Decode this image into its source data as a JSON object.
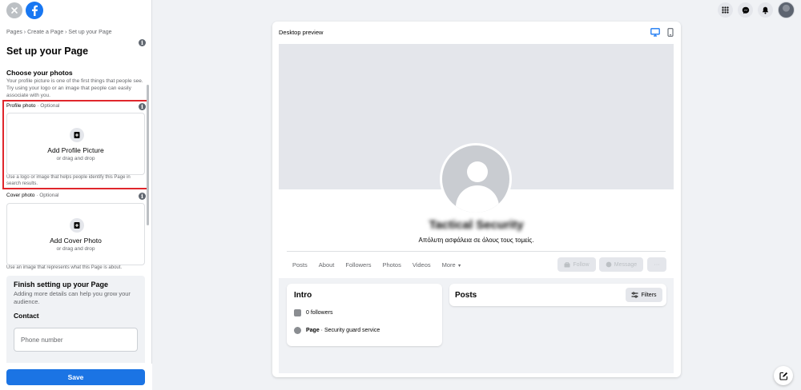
{
  "left_panel": {
    "breadcrumb": "Pages › Create a Page › Set up your Page",
    "title": "Set up your Page",
    "choose_photos": {
      "title": "Choose your photos",
      "description": "Your profile picture is one of the first things that people see. Try using your logo or an image that people can easily associate with you."
    },
    "profile_photo": {
      "label": "Profile photo",
      "optional": " · Optional",
      "button": "Add Profile Picture",
      "sub": "or drag and drop",
      "helper": "Use a logo or image that helps people identify this Page in search results."
    },
    "cover_photo": {
      "label": "Cover photo",
      "optional": " · Optional",
      "button": "Add Cover Photo",
      "sub": "or drag and drop",
      "helper": "Use an image that represents what this Page is about."
    },
    "finish": {
      "title": "Finish setting up your Page",
      "description": "Adding more details can help you grow your audience.",
      "contact_label": "Contact",
      "phone_placeholder": "Phone number"
    },
    "save_label": "Save"
  },
  "preview": {
    "title": "Desktop preview",
    "page_name": "Tactical Security",
    "page_subtitle": "Απόλυτη ασφάλεια σε όλους τους τομείς.",
    "tabs": [
      "Posts",
      "About",
      "Followers",
      "Photos",
      "Videos",
      "More"
    ],
    "buttons": {
      "follow": "Follow",
      "message": "Message",
      "more": "···"
    },
    "intro": {
      "title": "Intro",
      "followers": "0 followers",
      "page_type_label": "Page",
      "page_type_value": " · Security guard service"
    },
    "posts": {
      "title": "Posts",
      "filters": "Filters"
    }
  },
  "colors": {
    "brand_blue": "#1877f2",
    "highlight_red": "#e0262c",
    "save_blue": "#1b74e4"
  },
  "icons": [
    "close-icon",
    "facebook-logo",
    "info-icon",
    "camera-add-icon",
    "menu-grid-icon",
    "messenger-icon",
    "notifications-icon",
    "desktop-icon",
    "mobile-icon",
    "compose-icon",
    "filters-icon"
  ]
}
